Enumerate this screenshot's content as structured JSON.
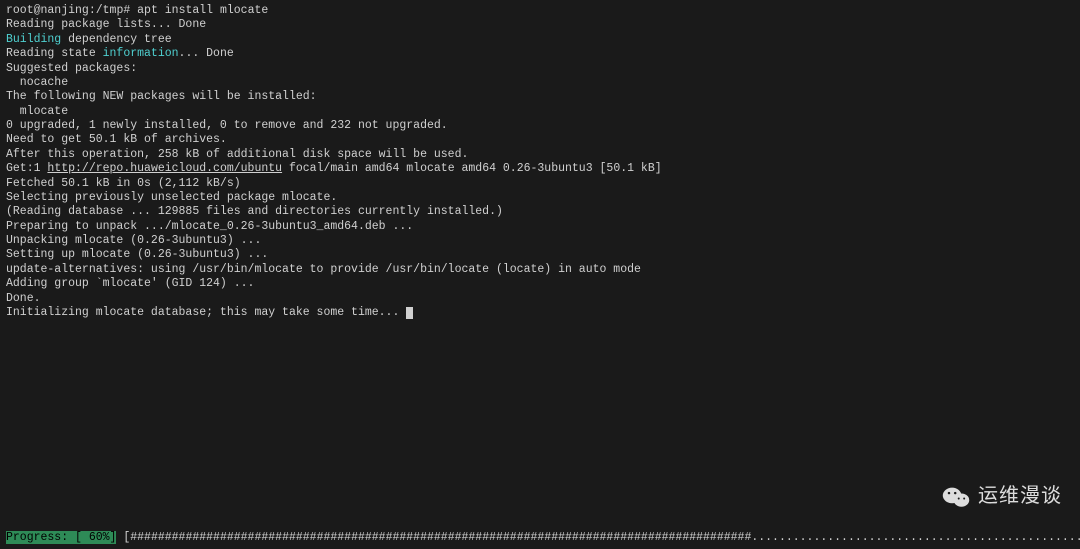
{
  "prompt": {
    "userhost": "root@nanjing",
    "cwd": "/tmp",
    "sep": "#",
    "command": "apt install mlocate"
  },
  "lines": {
    "l1": "Reading package lists... Done",
    "l2a": "Building",
    "l2b": " dependency tree",
    "l3a": "Reading state ",
    "l3b": "information",
    "l3c": "... Done",
    "l4": "Suggested packages:",
    "l5": "  nocache",
    "l6": "The following NEW packages will be installed:",
    "l7": "  mlocate",
    "l8": "0 upgraded, 1 newly installed, 0 to remove and 232 not upgraded.",
    "l9": "Need to get 50.1 kB of archives.",
    "l10": "After this operation, 258 kB of additional disk space will be used.",
    "l11a": "Get:1 ",
    "l11b": "http://repo.huaweicloud.com/ubuntu",
    "l11c": " focal/main amd64 mlocate amd64 0.26-3ubuntu3 [50.1 kB]",
    "l12": "Fetched 50.1 kB in 0s (2,112 kB/s)",
    "l13": "Selecting previously unselected package mlocate.",
    "l14": "(Reading database ... 129885 files and directories currently installed.)",
    "l15": "Preparing to unpack .../mlocate_0.26-3ubuntu3_amd64.deb ...",
    "l16": "Unpacking mlocate (0.26-3ubuntu3) ...",
    "l17": "Setting up mlocate (0.26-3ubuntu3) ...",
    "l18": "update-alternatives: using /usr/bin/mlocate to provide /usr/bin/locate (locate) in auto mode",
    "l19": "Adding group `mlocate' (GID 124) ...",
    "l20": "Done.",
    "l21": "Initializing mlocate database; this may take some time... "
  },
  "progress": {
    "label": "Progress:",
    "pct": " [ 60%]",
    "track": " [##########################################################################################............................................................] "
  },
  "watermark": {
    "text": "运维漫谈"
  }
}
